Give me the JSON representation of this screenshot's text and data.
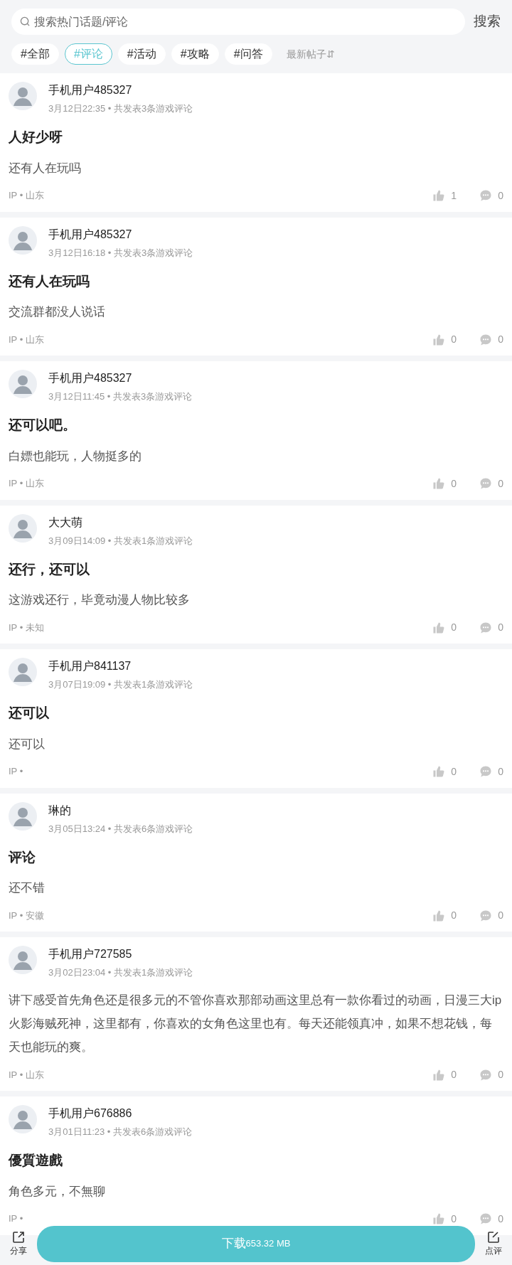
{
  "search": {
    "placeholder": "搜索热门话题/评论",
    "button": "搜索"
  },
  "tags": [
    {
      "label": "#全部",
      "selected": false
    },
    {
      "label": "#评论",
      "selected": true
    },
    {
      "label": "#活动",
      "selected": false
    },
    {
      "label": "#攻略",
      "selected": false
    },
    {
      "label": "#问答",
      "selected": false
    }
  ],
  "sort": {
    "label": "最新帖子",
    "icon": "⇵"
  },
  "posts": [
    {
      "user": "手机用户485327",
      "meta": "3月12日22:35 • 共发表3条游戏评论",
      "title": "人好少呀",
      "body": "还有人在玩吗",
      "ip": "IP • 山东",
      "likes": "1",
      "comments": "0"
    },
    {
      "user": "手机用户485327",
      "meta": "3月12日16:18 • 共发表3条游戏评论",
      "title": "还有人在玩吗",
      "body": "交流群都没人说话",
      "ip": "IP • 山东",
      "likes": "0",
      "comments": "0"
    },
    {
      "user": "手机用户485327",
      "meta": "3月12日11:45 • 共发表3条游戏评论",
      "title": "还可以吧。",
      "body": "白嫖也能玩，人物挺多的",
      "ip": "IP • 山东",
      "likes": "0",
      "comments": "0"
    },
    {
      "user": "大大萌",
      "meta": "3月09日14:09 • 共发表1条游戏评论",
      "title": "还行，还可以",
      "body": "这游戏还行，毕竟动漫人物比较多",
      "ip": "IP • 未知",
      "likes": "0",
      "comments": "0"
    },
    {
      "user": "手机用户841137",
      "meta": "3月07日19:09 • 共发表1条游戏评论",
      "title": "还可以",
      "body": "还可以",
      "ip": "IP •",
      "likes": "0",
      "comments": "0"
    },
    {
      "user": "琳的",
      "meta": "3月05日13:24 • 共发表6条游戏评论",
      "title": "评论",
      "body": "还不错",
      "ip": "IP • 安徽",
      "likes": "0",
      "comments": "0"
    },
    {
      "user": "手机用户727585",
      "meta": "3月02日23:04 • 共发表1条游戏评论",
      "body": "讲下感受首先角色还是很多元的不管你喜欢那部动画这里总有一款你看过的动画，日漫三大ip火影海贼死神，这里都有，你喜欢的女角色这里也有。每天还能领真冲，如果不想花钱，每天也能玩的爽。",
      "ip": "IP • 山东",
      "likes": "0",
      "comments": "0"
    },
    {
      "user": "手机用户676886",
      "meta": "3月01日11:23 • 共发表6条游戏评论",
      "title": "優質遊戲",
      "body": "角色多元，不無聊",
      "ip": "IP •",
      "likes": "0",
      "comments": "0"
    }
  ],
  "bottom_bar": {
    "share": "分享",
    "download": "下载",
    "size": "653.32 MB",
    "review": "点评"
  }
}
